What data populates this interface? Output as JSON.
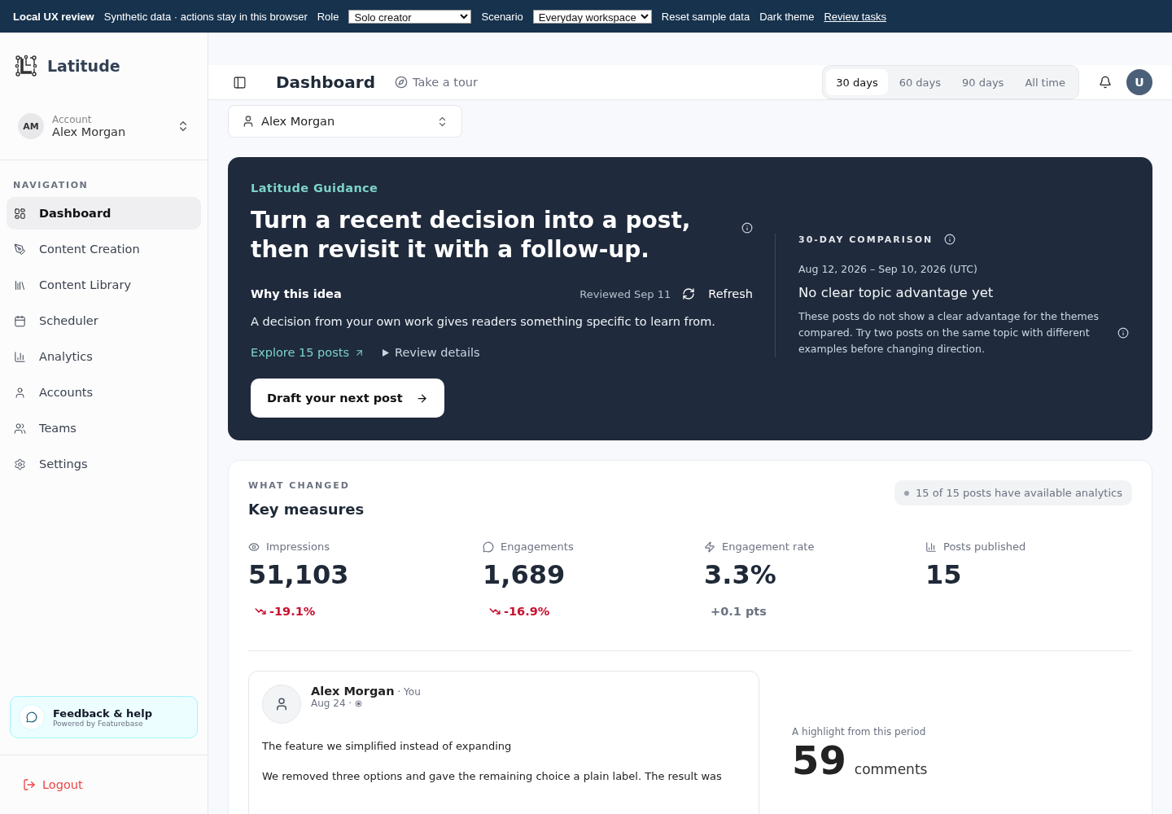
{
  "top_bar": {
    "brand": "Local UX review",
    "note": "Synthetic data · actions stay in this browser",
    "role": {
      "label": "Role",
      "value": "Solo creator"
    },
    "scenario": {
      "label": "Scenario",
      "value": "Everyday workspace"
    },
    "actions": [
      "Reset sample data",
      "Dark theme"
    ],
    "review_link": "Review tasks"
  },
  "sidebar": {
    "brand": "Latitude",
    "account": {
      "initials": "AM",
      "label": "Account",
      "name": "Alex Morgan"
    },
    "nav_heading": "NAVIGATION",
    "items": [
      {
        "label": "Dashboard",
        "selected": true
      },
      {
        "label": "Content Creation",
        "selected": false
      },
      {
        "label": "Content Library",
        "selected": false
      },
      {
        "label": "Scheduler",
        "selected": false
      },
      {
        "label": "Analytics",
        "selected": false
      },
      {
        "label": "Accounts",
        "selected": false
      },
      {
        "label": "Teams",
        "selected": false
      },
      {
        "label": "Settings",
        "selected": false
      }
    ],
    "feedback": {
      "title": "Feedback & help",
      "subtitle": "Powered by Featurebase"
    },
    "logout": "Logout"
  },
  "header": {
    "title": "Dashboard",
    "tour": "Take a tour",
    "ranges": [
      {
        "label": "30 days",
        "selected": true
      },
      {
        "label": "60 days",
        "selected": false
      },
      {
        "label": "90 days",
        "selected": false
      },
      {
        "label": "All time",
        "selected": false
      }
    ],
    "avatar": "U"
  },
  "account_select": "Alex Morgan",
  "guidance": {
    "eyebrow": "Latitude Guidance",
    "headline": "Turn a recent decision into a post, then revisit it with a follow-up.",
    "why_title": "Why this idea",
    "reviewed": "Reviewed Sep 11",
    "refresh": "Refresh",
    "body": "A decision from your own work gives readers something specific to learn from.",
    "explore_link": "Explore 15 posts",
    "review_details": "Review details",
    "cta": "Draft your next post",
    "comparison": {
      "heading": "30-DAY COMPARISON",
      "range": "Aug 12, 2026 – Sep 10, 2026 (UTC)",
      "title": "No clear topic advantage yet",
      "body": "These posts do not show a clear advantage for the themes compared. Try two posts on the same topic with different examples before changing direction."
    }
  },
  "key_measures": {
    "eyebrow": "WHAT CHANGED",
    "title": "Key measures",
    "badge": "15 of 15 posts have available analytics",
    "metrics": [
      {
        "label": "Impressions",
        "value": "51,103",
        "change": "-19.1%",
        "negative": true
      },
      {
        "label": "Engagements",
        "value": "1,689",
        "change": "-16.9%",
        "negative": true
      },
      {
        "label": "Engagement rate",
        "value": "3.3%",
        "change": "+0.1 pts",
        "negative": false
      },
      {
        "label": "Posts published",
        "value": "15"
      }
    ]
  },
  "post": {
    "author": "Alex Morgan",
    "you": "· You",
    "date": "Aug 24 ·",
    "title": "The feature we simplified instead of expanding",
    "body": "We removed three options and gave the remaining choice a plain label. The result was"
  },
  "highlight": {
    "label": "A highlight from this period",
    "value": "59",
    "unit": "comments"
  }
}
